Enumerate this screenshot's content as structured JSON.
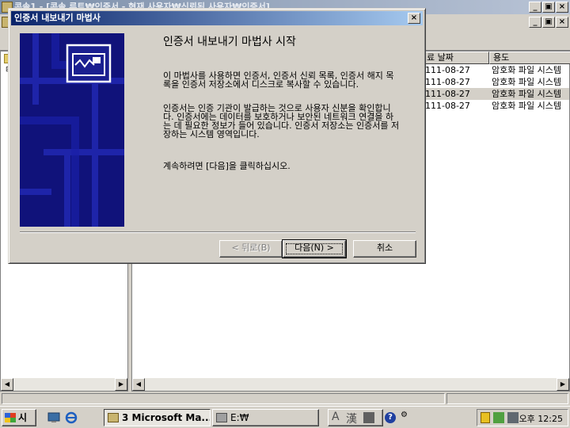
{
  "mmc": {
    "title": "콘솔1 - [콘솔 루트₩인증서 - 현재 사용자₩신뢰된 사용자₩인증서]",
    "columns": [
      "료 날짜",
      "용도"
    ],
    "rows": [
      {
        "date": "111-08-27",
        "purpose": "암호화 파일 시스템"
      },
      {
        "date": "111-08-27",
        "purpose": "암호화 파일 시스템"
      },
      {
        "date": "111-08-27",
        "purpose": "암호화 파일 시스템"
      },
      {
        "date": "111-08-27",
        "purpose": "암호화 파일 시스템"
      }
    ]
  },
  "wizard": {
    "title": "인증서 내보내기 마법사",
    "heading": "인증서 내보내기 마법사 시작",
    "para1": "이 마법사를 사용하면 인증서, 인증서 신뢰 목록, 인증서 해지 목록을 인증서 저장소에서 디스크로 복사할 수 있습니다.",
    "para2": "인증서는 인증 기관이 발급하는 것으로 사용자 신분을 확인합니다. 인증서에는 데이터를 보호하거나 보안된 네트워크 연결을 하는 데 필요한 정보가 들어 있습니다. 인증서 저장소는 인증서를 저장하는 시스템 영역입니다.",
    "para3": "계속하려면 [다음]을 클릭하십시오.",
    "back_label": "< 뒤로(B)",
    "next_label": "다음(N) >",
    "cancel_label": "취소"
  },
  "taskbar": {
    "start_label": "시작",
    "task1": "3 Microsoft Ma...",
    "task2": "E:₩",
    "clock": "오후 12:25"
  },
  "colors": {
    "wizard_title_start": "#0a246a",
    "wizard_title_end": "#a6caf0",
    "wizard_art": "#10127a"
  }
}
